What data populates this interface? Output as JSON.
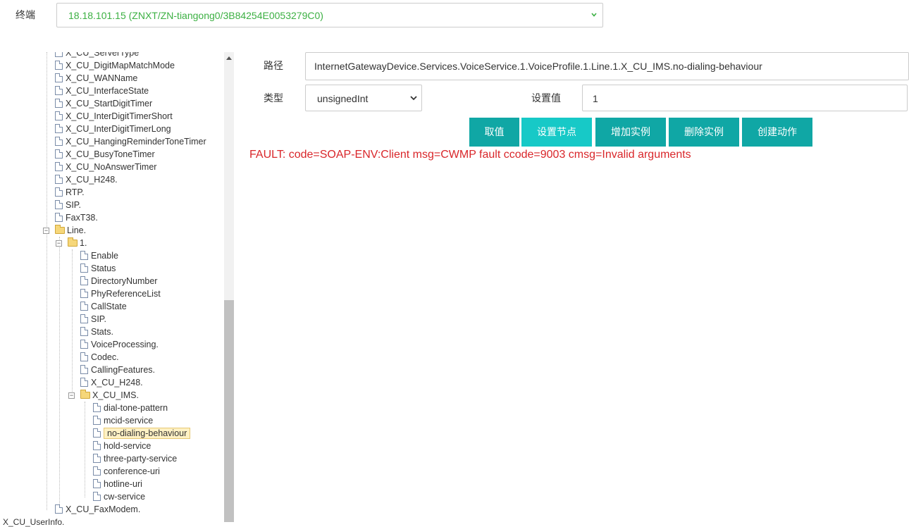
{
  "header": {
    "terminal_label": "终端",
    "terminal_value": "18.18.101.15 (ZNXT/ZN-tiangong0/3B84254E0053279C0)"
  },
  "tree": {
    "items_level1": [
      "X_CU_ServerType",
      "X_CU_DigitMapMatchMode",
      "X_CU_WANName",
      "X_CU_InterfaceState",
      "X_CU_StartDigitTimer",
      "X_CU_InterDigitTimerShort",
      "X_CU_InterDigitTimerLong",
      "X_CU_HangingReminderToneTimer",
      "X_CU_BusyToneTimer",
      "X_CU_NoAnswerTimer",
      "X_CU_H248.",
      "RTP.",
      "SIP.",
      "FaxT38."
    ],
    "line_folder": "Line.",
    "line1_folder": "1.",
    "line1_items": [
      "Enable",
      "Status",
      "DirectoryNumber",
      "PhyReferenceList",
      "CallState",
      "SIP.",
      "Stats.",
      "VoiceProcessing.",
      "Codec.",
      "CallingFeatures.",
      "X_CU_H248."
    ],
    "ims_folder": "X_CU_IMS.",
    "ims_items": [
      "dial-tone-pattern",
      "mcid-service",
      "no-dialing-behaviour",
      "hold-service",
      "three-party-service",
      "conference-uri",
      "hotline-uri",
      "cw-service"
    ],
    "after_items": [
      "X_CU_FaxModem."
    ],
    "bottom_item": "X_CU_UserInfo."
  },
  "form": {
    "path_label": "路径",
    "path_value": "InternetGatewayDevice.Services.VoiceService.1.VoiceProfile.1.Line.1.X_CU_IMS.no-dialing-behaviour",
    "type_label": "类型",
    "type_value": "unsignedInt",
    "set_value_label": "设置值",
    "set_value": "1"
  },
  "buttons": {
    "get_value": "取值",
    "set_node": "设置节点",
    "add_instance": "增加实例",
    "delete_instance": "删除实例",
    "create_action": "创建动作"
  },
  "fault_message": "FAULT: code=SOAP-ENV:Client msg=CWMP fault ccode=9003 cmsg=Invalid arguments",
  "colors": {
    "button": "#10a7a5",
    "button_active": "#17c9c7",
    "fault": "#d9262a",
    "terminal_text": "#3cb043"
  }
}
